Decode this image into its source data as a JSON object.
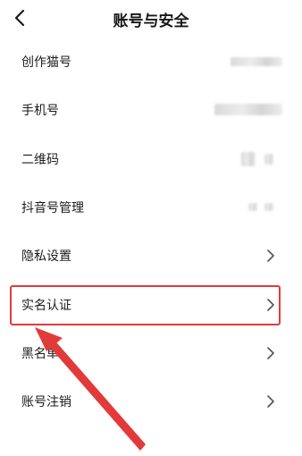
{
  "header": {
    "title": "账号与安全"
  },
  "rows": [
    {
      "label": "创作猫号"
    },
    {
      "label": "手机号"
    },
    {
      "label": "二维码"
    },
    {
      "label": "抖音号管理"
    },
    {
      "label": "隐私设置"
    },
    {
      "label": "实名认证"
    },
    {
      "label": "黑名单"
    },
    {
      "label": "账号注销"
    }
  ],
  "icons": {
    "back": "back-arrow-icon",
    "chevron": "chevron-right-icon"
  },
  "colors": {
    "highlight": "#e23a3a",
    "arrow": "#e23a3a"
  }
}
